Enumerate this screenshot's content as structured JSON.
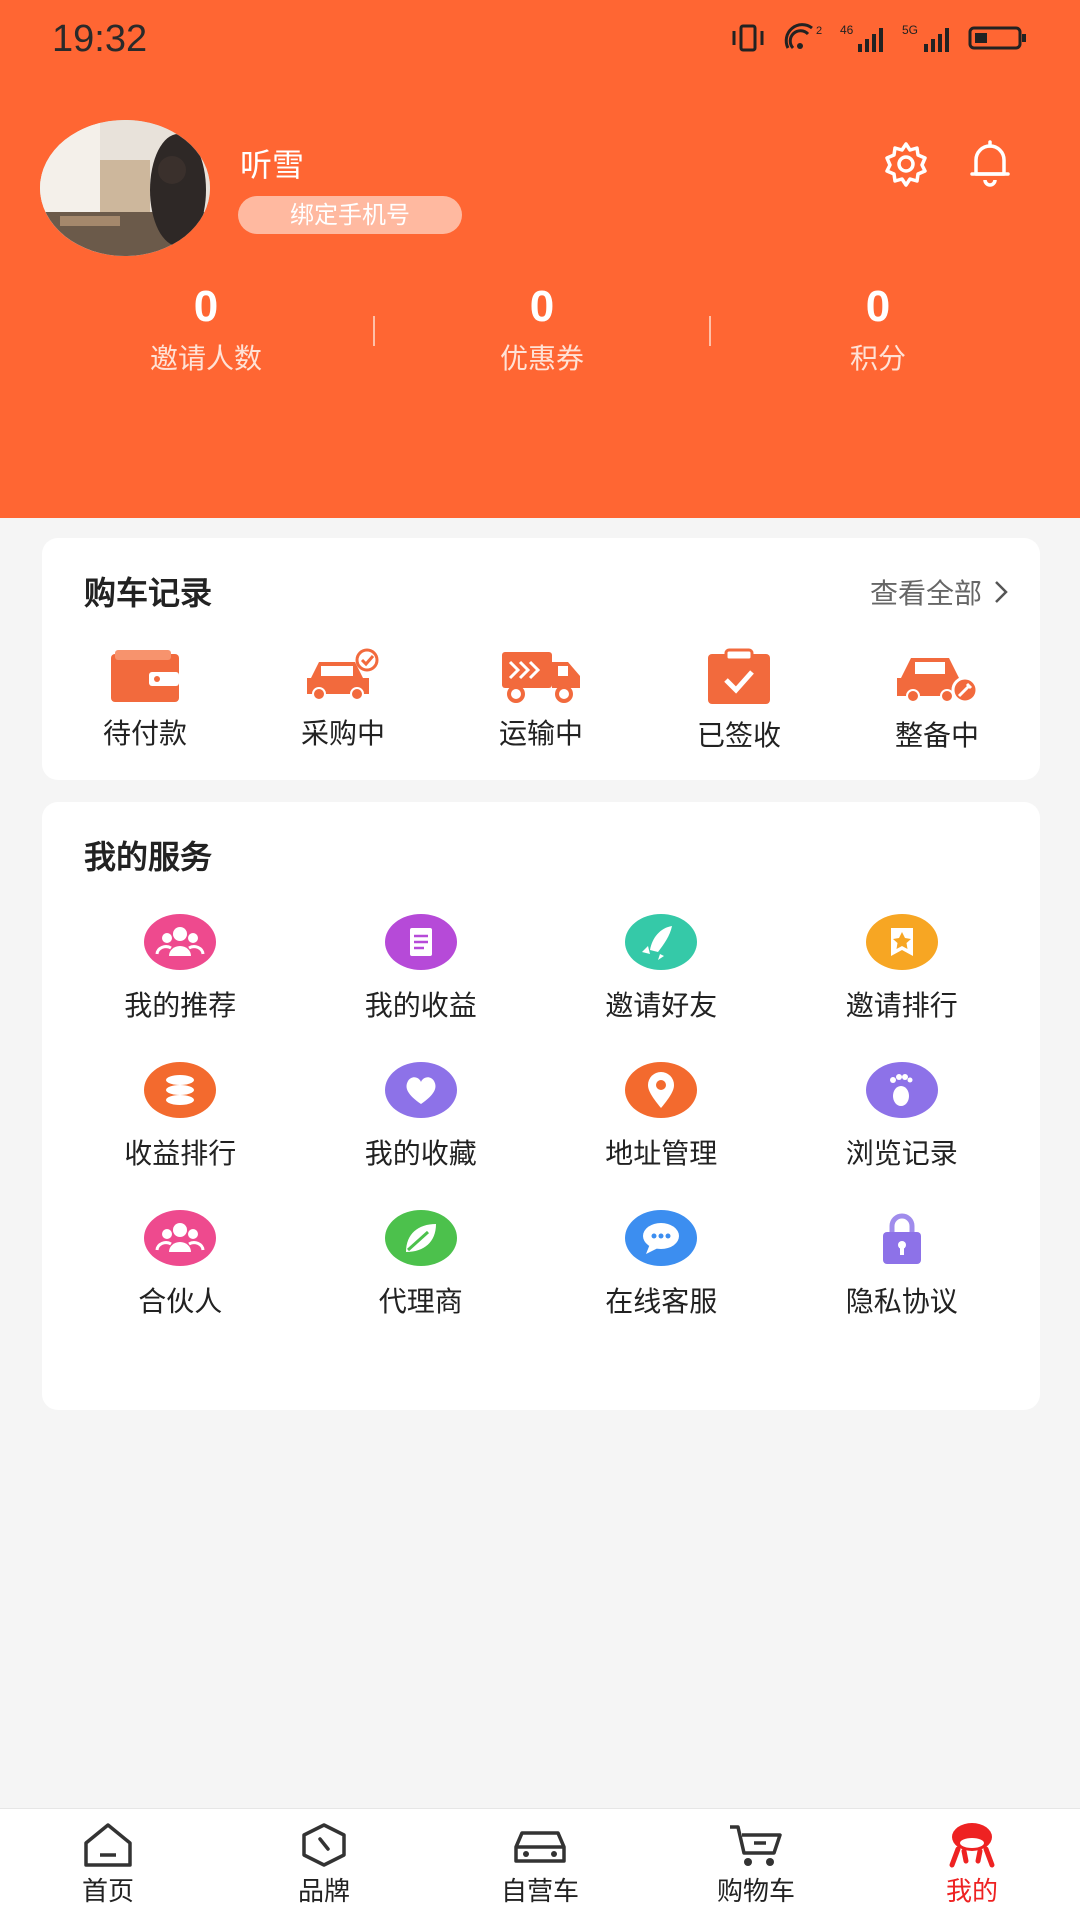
{
  "status_bar": {
    "time": "19:32"
  },
  "profile": {
    "username": "听雪",
    "bind_phone_label": "绑定手机号"
  },
  "stats": [
    {
      "value": "0",
      "label": "邀请人数"
    },
    {
      "value": "0",
      "label": "优惠券"
    },
    {
      "value": "0",
      "label": "积分"
    }
  ],
  "orders": {
    "title": "购车记录",
    "view_all": "查看全部",
    "items": [
      {
        "label": "待付款",
        "icon": "wallet-icon"
      },
      {
        "label": "采购中",
        "icon": "car-check-icon"
      },
      {
        "label": "运输中",
        "icon": "truck-icon"
      },
      {
        "label": "已签收",
        "icon": "clipboard-check-icon"
      },
      {
        "label": "整备中",
        "icon": "car-wrench-icon"
      }
    ]
  },
  "services": {
    "title": "我的服务",
    "items": [
      {
        "label": "我的推荐",
        "icon": "people-icon"
      },
      {
        "label": "我的收益",
        "icon": "document-icon"
      },
      {
        "label": "邀请好友",
        "icon": "rocket-icon"
      },
      {
        "label": "邀请排行",
        "icon": "star-badge-icon"
      },
      {
        "label": "收益排行",
        "icon": "coins-icon"
      },
      {
        "label": "我的收藏",
        "icon": "heart-icon"
      },
      {
        "label": "地址管理",
        "icon": "location-pin-icon"
      },
      {
        "label": "浏览记录",
        "icon": "footprint-icon"
      },
      {
        "label": "合伙人",
        "icon": "people-icon"
      },
      {
        "label": "代理商",
        "icon": "leaf-icon"
      },
      {
        "label": "在线客服",
        "icon": "chat-bubble-icon"
      },
      {
        "label": "隐私协议",
        "icon": "lock-icon"
      }
    ]
  },
  "tabbar": {
    "items": [
      {
        "label": "首页",
        "icon": "home-icon"
      },
      {
        "label": "品牌",
        "icon": "brand-hexagon-icon"
      },
      {
        "label": "自营车",
        "icon": "car-icon"
      },
      {
        "label": "购物车",
        "icon": "cart-icon"
      },
      {
        "label": "我的",
        "icon": "profile-mascot-icon"
      }
    ],
    "active_index": 4
  },
  "colors": {
    "primary": "#ff6633",
    "active_tab": "#ee2222"
  }
}
